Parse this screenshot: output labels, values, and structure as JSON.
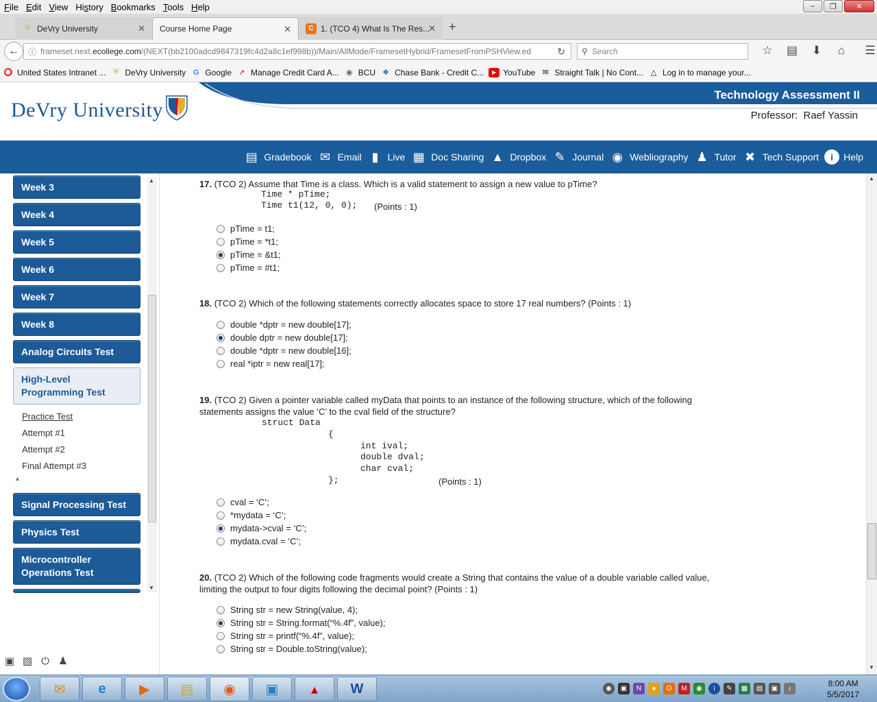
{
  "menu": [
    "File",
    "Edit",
    "View",
    "History",
    "Bookmarks",
    "Tools",
    "Help"
  ],
  "menu_underline": [
    "F",
    "E",
    "V",
    "s",
    "B",
    "T",
    "H"
  ],
  "tabs": [
    {
      "label": "DeVry University"
    },
    {
      "label": "Course Home Page"
    },
    {
      "label": "1. (TCO 4) What Is The Res..."
    }
  ],
  "url": {
    "prefix": "frameset.next.",
    "domain": "ecollege.com",
    "path": "/(NEXT(bb2100adcd9847319fc4d2a8c1ef998b))/Main/AllMode/FramesetHybrid/FramesetFromPSHView.ed"
  },
  "search_placeholder": "Search",
  "bookmarks": [
    {
      "label": "United States Intranet ...",
      "icon": "red-circle-icon"
    },
    {
      "label": "DeVry University",
      "icon": "shield-icon"
    },
    {
      "label": "Google",
      "icon": "google-icon"
    },
    {
      "label": "Manage Credit Card A...",
      "icon": "arrow-icon"
    },
    {
      "label": "BCU",
      "icon": "globe-icon"
    },
    {
      "label": "Chase Bank - Credit C...",
      "icon": "chase-icon"
    },
    {
      "label": "YouTube",
      "icon": "youtube-icon"
    },
    {
      "label": "Straight Talk | No Cont...",
      "icon": "chat-icon"
    },
    {
      "label": "Log in to manage your...",
      "icon": "roof-icon"
    }
  ],
  "header": {
    "logo": "DeVry University",
    "course_title": "Technology Assessment II",
    "professor_label": "Professor:",
    "professor_name": "Raef Yassin"
  },
  "toolbar": [
    {
      "label": "Gradebook",
      "icon": "gradebook-icon"
    },
    {
      "label": "Email",
      "icon": "envelope-icon"
    },
    {
      "label": "Live",
      "icon": "chat-bubble-icon"
    },
    {
      "label": "Doc Sharing",
      "icon": "doc-icon"
    },
    {
      "label": "Dropbox",
      "icon": "dropbox-icon"
    },
    {
      "label": "Journal",
      "icon": "journal-icon"
    },
    {
      "label": "Webliography",
      "icon": "globe-icon"
    },
    {
      "label": "Tutor",
      "icon": "people-icon"
    },
    {
      "label": "Tech Support",
      "icon": "tools-icon"
    },
    {
      "label": "Help",
      "icon": "info-icon"
    }
  ],
  "sidebar": {
    "items": [
      {
        "label": "Week 3"
      },
      {
        "label": "Week 4"
      },
      {
        "label": "Week 5"
      },
      {
        "label": "Week 6"
      },
      {
        "label": "Week 7"
      },
      {
        "label": "Week 8"
      },
      {
        "label": "Analog Circuits Test"
      },
      {
        "label": "High-Level Programming Test"
      },
      {
        "label": "Signal Processing Test"
      },
      {
        "label": "Physics Test"
      },
      {
        "label": "Microcontroller Operations Test"
      }
    ],
    "subitems": [
      {
        "label": "Practice Test"
      },
      {
        "label": "Attempt #1"
      },
      {
        "label": "Attempt #2"
      },
      {
        "label": "Final Attempt #3"
      }
    ]
  },
  "questions": [
    {
      "num": "17.",
      "text": "(TCO 2) Assume that Time is a class. Which is a valid statement to assign a new value to pTime?",
      "code": [
        "Time * pTime;",
        "Time t1(12, 0, 0);"
      ],
      "points": "(Points : 1)",
      "options": [
        "pTime = t1;",
        "pTime = *t1;",
        "pTime = &t1;",
        "pTime = #t1;"
      ],
      "selected": 2
    },
    {
      "num": "18.",
      "text": "(TCO 2) Which of the following statements correctly allocates space to store 17 real numbers? (Points : 1)",
      "options": [
        "double *dptr = new double[17];",
        "double dptr = new double[17];",
        "double *dptr = new double[16];",
        "real *iptr = new real[17];"
      ],
      "selected": 1
    },
    {
      "num": "19.",
      "text1": "(TCO 2) Given a pointer variable called myData that points to an instance of the following structure, which of the following",
      "text2": "statements assigns the value ‘C’ to the cval field of the structure?",
      "code": [
        "struct Data",
        "{",
        "int ival;",
        "double dval;",
        "char cval;",
        "};"
      ],
      "points": "(Points : 1)",
      "options": [
        "cval = ‘C’;",
        "*mydata = ‘C’;",
        "mydata->cval = ‘C’;",
        "mydata.cval = ‘C’;"
      ],
      "selected": 2
    },
    {
      "num": "20.",
      "text1": "(TCO 2) Which of the following code fragments would create a String that contains the value of a double variable called value,",
      "text2": "limiting the output to four digits following the decimal point? (Points : 1)",
      "options": [
        "String str = new String(value, 4);",
        "String str = String.format(“%.4f”, value);",
        "String str = printf(“%.4f”, value);",
        "String str = Double.toString(value);"
      ],
      "selected": 1
    }
  ],
  "clock": {
    "time": "8:00 AM",
    "date": "5/5/2017"
  },
  "colors": {
    "brand_blue": "#1c5a98",
    "toolbar_blue": "#1b5c9b",
    "logo_blue": "#1d5796"
  }
}
